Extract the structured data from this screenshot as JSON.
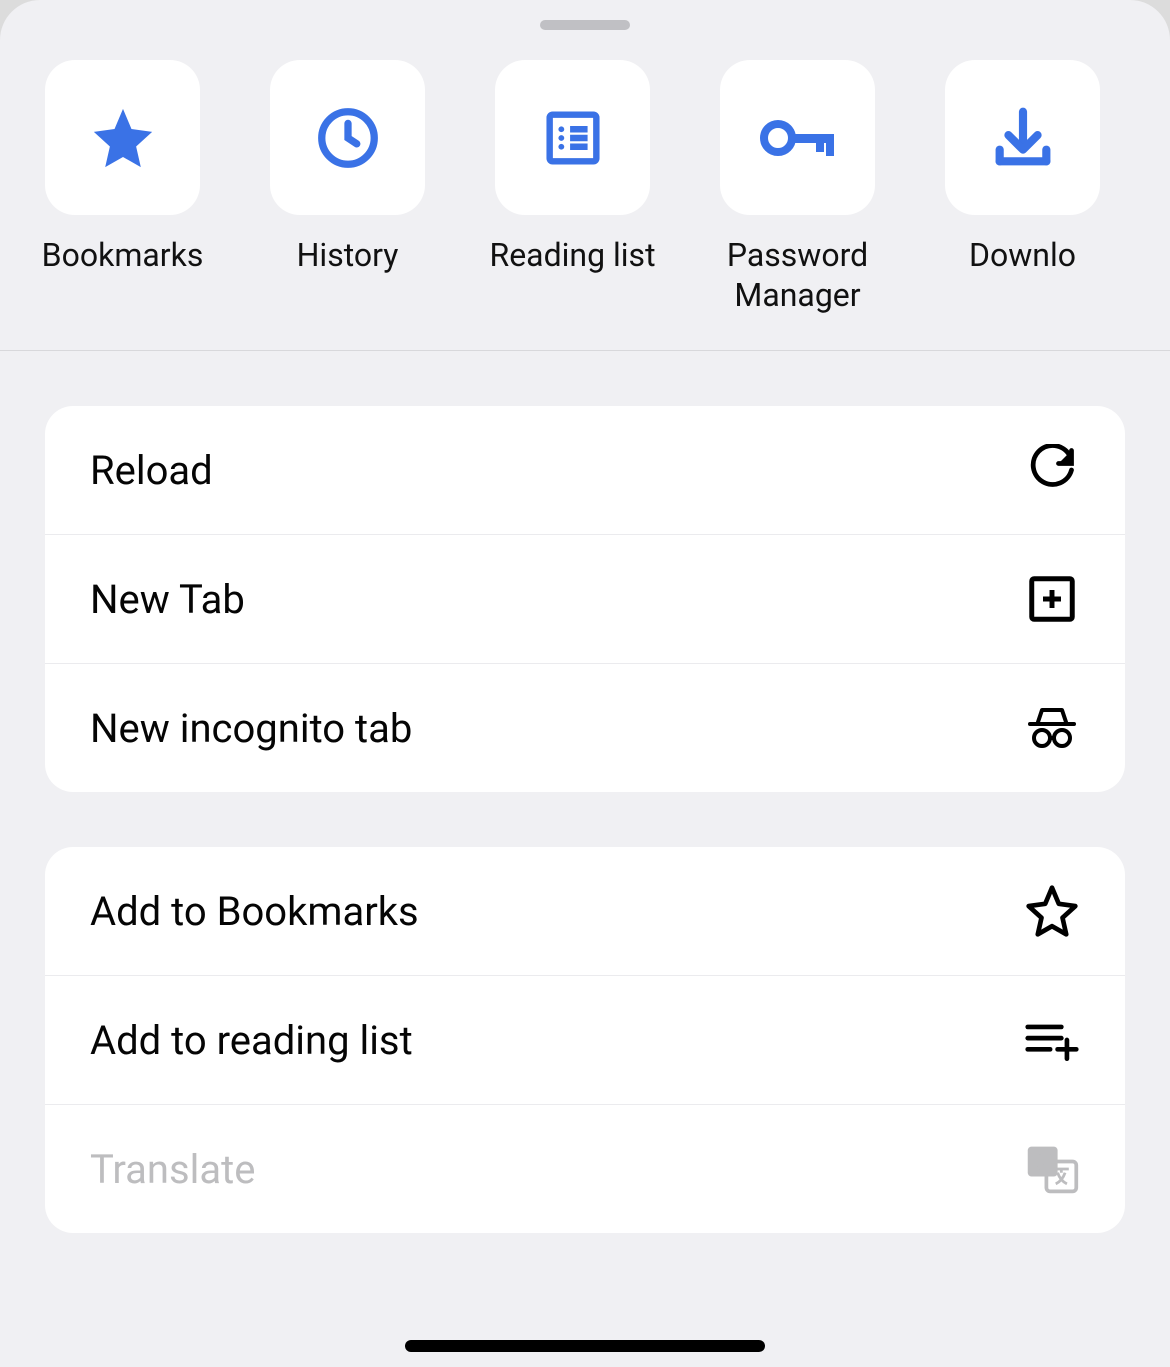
{
  "colors": {
    "accent": "#3A72E6",
    "text": "#050505",
    "disabled": "#bdbdbf"
  },
  "shortcuts": [
    {
      "label": "Bookmarks",
      "icon": "star"
    },
    {
      "label": "History",
      "icon": "clock"
    },
    {
      "label": "Reading list",
      "icon": "reading-list"
    },
    {
      "label": "Password Manager",
      "icon": "key",
      "wrap": true
    },
    {
      "label": "Downlo",
      "icon": "download"
    }
  ],
  "menu": {
    "sections": [
      {
        "items": [
          {
            "label": "Reload",
            "icon": "reload"
          },
          {
            "label": "New Tab",
            "icon": "plus-square"
          },
          {
            "label": "New incognito tab",
            "icon": "incognito"
          }
        ]
      },
      {
        "items": [
          {
            "label": "Add to Bookmarks",
            "icon": "star-outline"
          },
          {
            "label": "Add to reading list",
            "icon": "list-add"
          },
          {
            "label": "Translate",
            "icon": "translate",
            "disabled": true
          }
        ]
      }
    ]
  }
}
